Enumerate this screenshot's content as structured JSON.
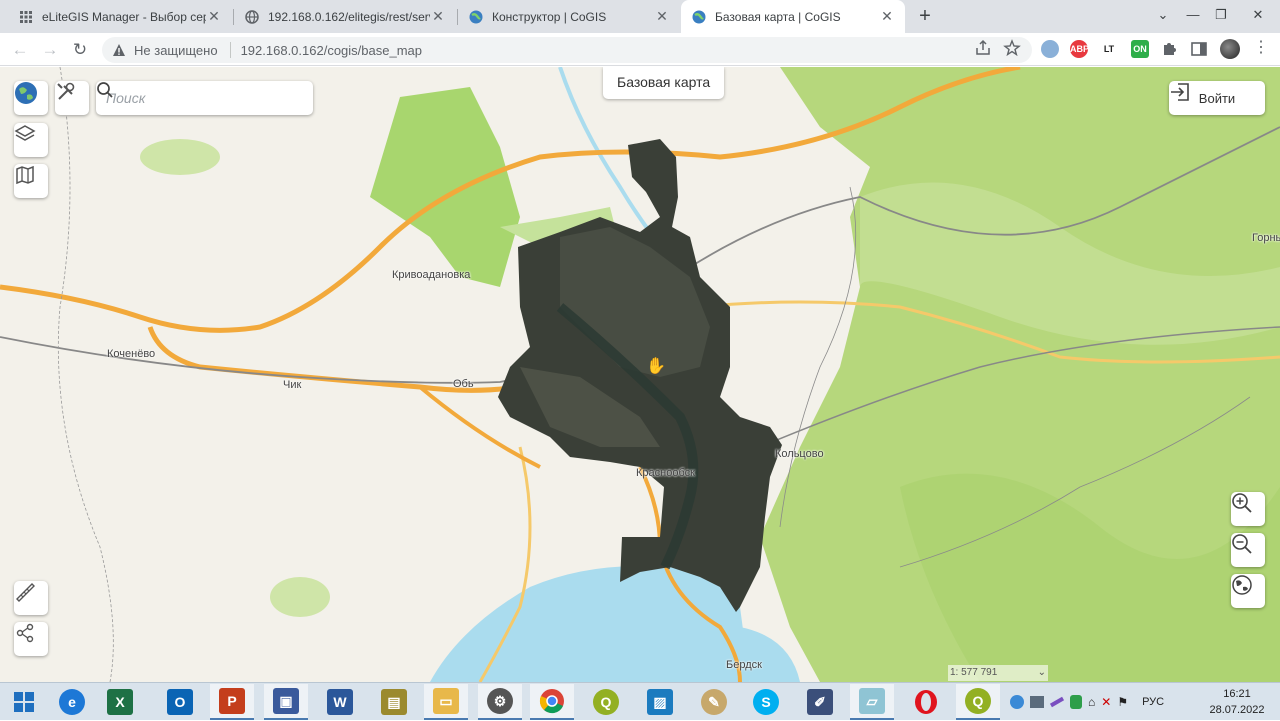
{
  "browser": {
    "tabs": [
      {
        "title": "eLiteGIS Manager - Выбор серв",
        "favicon": "grid-icon",
        "active": false
      },
      {
        "title": "192.168.0.162/elitegis/rest/servic",
        "favicon": "globe-icon",
        "active": false
      },
      {
        "title": "Конструктор | CoGIS",
        "favicon": "cogis-icon",
        "active": false
      },
      {
        "title": "Базовая карта | CoGIS",
        "favicon": "cogis-icon",
        "active": true
      }
    ],
    "security_label": "Не защищено",
    "url": "192.168.0.162/cogis/base_map",
    "extensions": [
      "ABP",
      "LT",
      "ON"
    ]
  },
  "map": {
    "title": "Базовая карта",
    "search_placeholder": "Поиск",
    "login_label": "Войти",
    "scale_label": "1: 577 791",
    "places": [
      "Кривоадановка",
      "Коченёво",
      "Чик",
      "Обь",
      "Краснообск",
      "Кольцово",
      "Бердск",
      "Горны"
    ],
    "colors": {
      "land": "#f3f1ea",
      "forest": "#b5d97b",
      "park": "#a8d66e",
      "water": "#aadcee",
      "highway": "#f2a93b",
      "satellite": "#3a3f37"
    }
  },
  "taskbar": {
    "apps": [
      "windows-start-icon",
      "edge-icon",
      "excel-icon",
      "outlook-icon",
      "powerpoint-icon",
      "explorer-app-icon",
      "word-icon",
      "archive-icon",
      "files-icon",
      "settings-app-icon",
      "chrome-icon",
      "qgis-icon",
      "photos-icon",
      "paint-icon",
      "skype-icon",
      "tool-icon",
      "notes-icon",
      "opera-icon",
      "qgis2-icon"
    ],
    "language": "РУС",
    "time": "16:21",
    "date": "28.07.2022"
  }
}
